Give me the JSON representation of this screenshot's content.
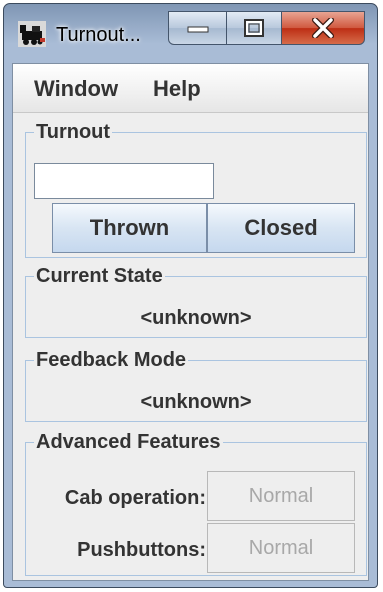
{
  "window": {
    "title": "Turnout...",
    "controls": {
      "minimize_icon": "minimize-icon",
      "maximize_icon": "maximize-icon",
      "close_icon": "close-icon"
    }
  },
  "menu": [
    {
      "label": "Window"
    },
    {
      "label": "Help"
    }
  ],
  "turnout": {
    "group_title": "Turnout",
    "input_value": "",
    "thrown_label": "Thrown",
    "closed_label": "Closed"
  },
  "current_state": {
    "group_title": "Current State",
    "value": "<unknown>"
  },
  "feedback_mode": {
    "group_title": "Feedback Mode",
    "value": "<unknown>"
  },
  "advanced": {
    "group_title": "Advanced Features",
    "cab_operation_label": "Cab operation:",
    "cab_operation_value": "Normal",
    "pushbuttons_label": "Pushbuttons:",
    "pushbuttons_value": "Normal"
  },
  "colors": {
    "accent": "#c5d8ee",
    "close_button": "#c8432a",
    "group_border": "#aac4e0"
  }
}
